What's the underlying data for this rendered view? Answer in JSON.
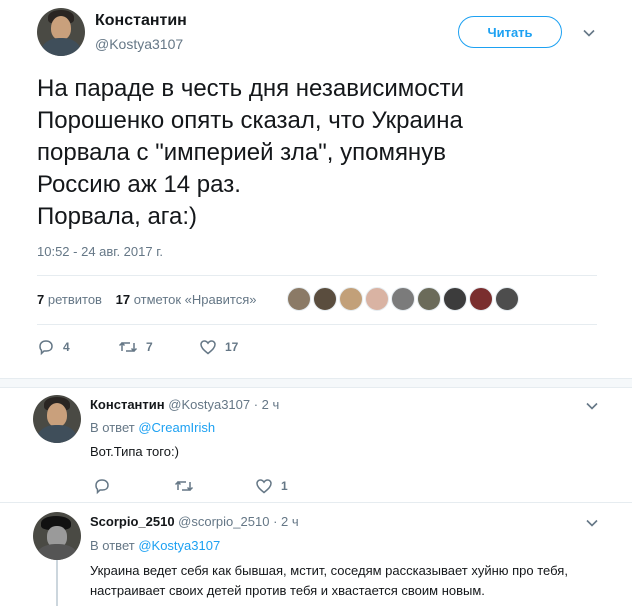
{
  "main_tweet": {
    "display_name": "Константин",
    "handle": "@Kostya3107",
    "follow_label": "Читать",
    "text": "На параде в честь дня независимости\nПорошенко опять сказал, что Украина\nпорвала с \"империей зла\", упомянув\nРоссию аж 14 раз.\nПорвала, ага:)",
    "timestamp": "10:52 - 24 авг. 2017 г.",
    "retweets_count": "7",
    "retweets_label": "ретвитов",
    "likes_count": "17",
    "likes_label": "отметок «Нравится»",
    "liker_colors": [
      "#8b7a66",
      "#5a4d3e",
      "#c2a079",
      "#d9b3a3",
      "#7b7b7b",
      "#6b6b5a",
      "#3c3c3c",
      "#7a2e2e",
      "#4d4d4d"
    ],
    "actions": {
      "reply_count": "4",
      "retweet_count": "7",
      "like_count": "17"
    }
  },
  "replies": [
    {
      "display_name": "Константин",
      "handle": "@Kostya3107",
      "time": "· 2 ч",
      "in_reply_prefix": "В ответ",
      "in_reply_to": "@CreamIrish",
      "text": "Вот.Типа того:)",
      "actions": {
        "reply_count": "",
        "retweet_count": "",
        "like_count": "1"
      }
    },
    {
      "display_name": "Scorpio_2510",
      "handle": "@scorpio_2510",
      "time": "· 2 ч",
      "in_reply_prefix": "В ответ",
      "in_reply_to": "@Kostya3107",
      "text": "Украина ведет себя как бывшая, мстит, соседям рассказывает хуйню про тебя, настраивает своих детей против тебя и хвастается своим новым."
    }
  ],
  "colors": {
    "accent": "#1da1f2",
    "secondary_text": "#657786",
    "divider": "#e6ecf0"
  },
  "icons": [
    "reply-icon",
    "retweet-icon",
    "like-icon",
    "chevron-down-icon"
  ]
}
